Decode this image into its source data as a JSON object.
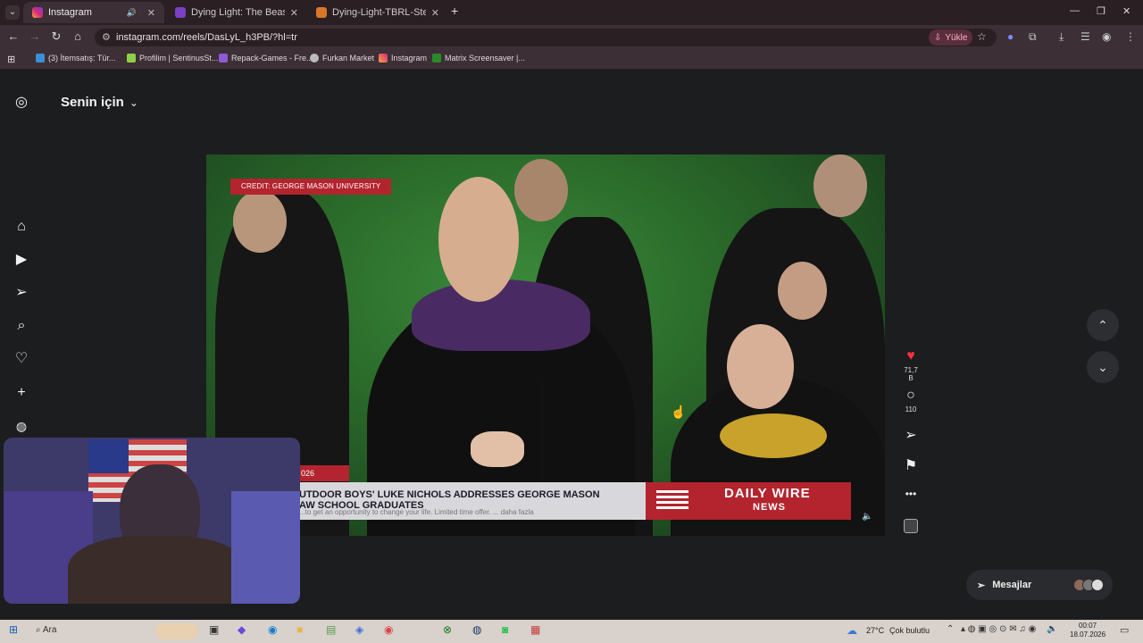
{
  "browser": {
    "tabs": [
      {
        "title": "Instagram",
        "active": true
      },
      {
        "title": "Dying Light: The Beast Restored",
        "active": false
      },
      {
        "title": "Dying-Light-TBRL-SteamRIP.com",
        "active": false
      }
    ],
    "new_tab": "+",
    "url": "instagram.com/reels/DasLyL_h3PB/?hl=tr",
    "yukle_label": "Yükle",
    "bookmarks": [
      "(3) İtemsatış: Tür...",
      "Profilim | SentinusSt...",
      "Repack-Games - Fre...",
      "Furkan Market",
      "Instagram",
      "Matrix Screensaver |..."
    ]
  },
  "sidebar": {
    "items": [
      "instagram-logo",
      "home",
      "reels",
      "messages",
      "search",
      "notifications",
      "create",
      "profile"
    ]
  },
  "feed": {
    "title": "Senin için",
    "chevron": "⌄"
  },
  "video": {
    "credit": "CREDIT: GEORGE MASON UNIVERSITY",
    "year_tag": "026",
    "headline_1": "UTDOOR BOYS' LUKE NICHOLS ADDRESSES GEORGE MASON",
    "headline_2": "AW SCHOOL GRADUATES",
    "caption": "...to get an opportunity to change your life. Limited time offer. ... daha fazla",
    "brand_1": "DAILY WIRE",
    "brand_2": "NEWS"
  },
  "actions": {
    "likes": "71,7 B",
    "comments": "110"
  },
  "messages": {
    "label": "Mesajlar"
  },
  "taskbar": {
    "search": "Ara",
    "temp": "27°C",
    "weather": "Çok bulutlu",
    "time": "00:07",
    "date": "18.07.2026"
  },
  "colors": {
    "accent_red": "#b3242e",
    "like_red": "#ff3040"
  }
}
